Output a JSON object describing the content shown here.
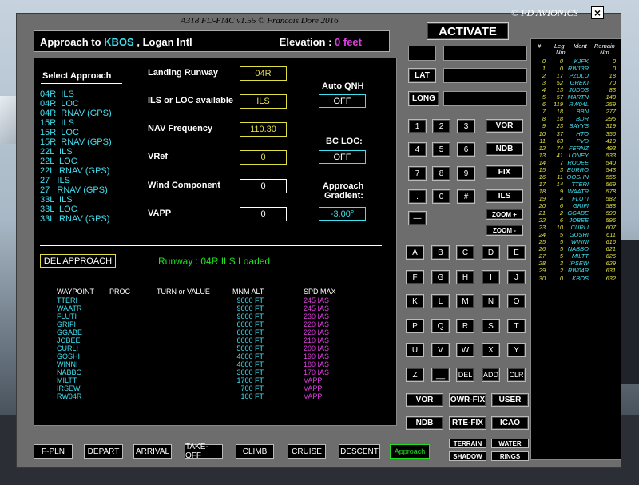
{
  "window": {
    "title": "A318 FD-FMC v1.55 © Francois Dore 2016",
    "brand": "© FD AVIONICS",
    "close_symbol": "×"
  },
  "header": {
    "prefix": "Approach to ",
    "icao": "KBOS",
    "airport": " , Logan Intl",
    "elevation_label": "Elevation : ",
    "elevation_value": "0 feet"
  },
  "approach_list": {
    "title": "Select Approach",
    "items": [
      "04R  ILS",
      "04R  LOC",
      "04R  RNAV (GPS)",
      "15R  ILS",
      "15R  LOC",
      "15R  RNAV (GPS)",
      "22L  ILS",
      "22L  LOC",
      "22L  RNAV (GPS)",
      "27   ILS",
      "27   RNAV (GPS)",
      "33L  ILS",
      "33L  LOC",
      "33L  RNAV (GPS)"
    ]
  },
  "fields": {
    "landing_runway_label": "Landing Runway",
    "landing_runway": "04R",
    "ils_label": "ILS or LOC available",
    "ils_value": "ILS",
    "nav_freq_label": "NAV Frequency",
    "nav_freq": "110.30",
    "vref_label": "VRef",
    "vref": "0",
    "wind_label": "Wind Component",
    "wind": "0",
    "vapp_label": "VAPP",
    "vapp": "0",
    "auto_qnh_label": "Auto QNH",
    "auto_qnh": "OFF",
    "bc_loc_label": "BC LOC:",
    "bc_loc": "OFF",
    "gradient_label_1": "Approach",
    "gradient_label_2": "Gradient:",
    "gradient": "-3.00°"
  },
  "status": {
    "del_approach": "DEL APPROACH",
    "loaded_msg": "Runway : 04R  ILS  Loaded"
  },
  "waypoint_table": {
    "headers": {
      "waypoint": "WAYPOINT",
      "proc": "PROC",
      "turn": "TURN or VALUE",
      "alt": "MNM ALT",
      "spd": "SPD MAX"
    },
    "rows": [
      {
        "wp": "TTERI",
        "alt": "9000 FT",
        "spd": "245 IAS"
      },
      {
        "wp": "WAATR",
        "alt": "9000 FT",
        "spd": "245 IAS"
      },
      {
        "wp": "FLUTI",
        "alt": "9000 FT",
        "spd": "230 IAS"
      },
      {
        "wp": "GRIFI",
        "alt": "6000 FT",
        "spd": "220 IAS"
      },
      {
        "wp": "GGABE",
        "alt": "6000 FT",
        "spd": "220 IAS"
      },
      {
        "wp": "JOBEE",
        "alt": "6000 FT",
        "spd": "210 IAS"
      },
      {
        "wp": "CURLI",
        "alt": "5000 FT",
        "spd": "200 IAS"
      },
      {
        "wp": "GOSHI",
        "alt": "4000 FT",
        "spd": "190 IAS"
      },
      {
        "wp": "WINNI",
        "alt": "4000 FT",
        "spd": "180 IAS"
      },
      {
        "wp": "NABBO",
        "alt": "3000 FT",
        "spd": "170 IAS"
      },
      {
        "wp": "MILTT",
        "alt": "1700 FT",
        "spd": "VAPP"
      },
      {
        "wp": "IRSEW",
        "alt": "700 FT",
        "spd": "VAPP"
      },
      {
        "wp": "RW04R",
        "alt": "100 FT",
        "spd": "VAPP"
      }
    ]
  },
  "keypad": {
    "activate": "ACTIVATE",
    "lat": "LAT",
    "long": "LONG",
    "digits": [
      "1",
      "2",
      "3",
      "4",
      "5",
      "6",
      "7",
      "8",
      "9",
      ".",
      "0",
      "#",
      "—"
    ],
    "nav": {
      "vor": "VOR",
      "ndb": "NDB",
      "fix": "FIX",
      "ils": "ILS",
      "zoom_in": "ZOOM +",
      "zoom_out": "ZOOM -"
    },
    "letters": [
      "A",
      "B",
      "C",
      "D",
      "E",
      "F",
      "G",
      "H",
      "I",
      "J",
      "K",
      "L",
      "M",
      "N",
      "O",
      "P",
      "Q",
      "R",
      "S",
      "T",
      "U",
      "V",
      "W",
      "X",
      "Y",
      "Z",
      "__",
      "DEL",
      "ADD",
      "CLR"
    ],
    "bottom": {
      "vor": "VOR",
      "owr_fix": "OWR-FIX",
      "user": "USER",
      "ndb": "NDB",
      "rte_fix": "RTE-FIX",
      "icao": "ICAO",
      "terrain": "TERRAIN",
      "water": "WATER",
      "shadow": "SHADOW",
      "rings": "RINGS"
    }
  },
  "tabs": [
    "F-PLN",
    "DEPART",
    "ARRIVAL",
    "TAKE-OFF",
    "CLIMB",
    "CRUISE",
    "DESCENT",
    "Approach"
  ],
  "legs": {
    "headers": {
      "num": "#",
      "leg": "Leg",
      "leg_unit": "Nm",
      "ident": "Ident",
      "remain": "Remain",
      "remain_unit": "Nm"
    },
    "rows": [
      {
        "n": "0",
        "l": "0",
        "id": "KJFK",
        "r": "0"
      },
      {
        "n": "1",
        "l": "0",
        "id": "RW13R",
        "r": "0"
      },
      {
        "n": "2",
        "l": "17",
        "id": "PZULU",
        "r": "18"
      },
      {
        "n": "3",
        "l": "52",
        "id": "GREKI",
        "r": "70"
      },
      {
        "n": "4",
        "l": "13",
        "id": "JUDDS",
        "r": "83"
      },
      {
        "n": "5",
        "l": "57",
        "id": "MARTN",
        "r": "140"
      },
      {
        "n": "6",
        "l": "119",
        "id": "RW04L",
        "r": "259"
      },
      {
        "n": "7",
        "l": "18",
        "id": "BBN",
        "r": "277"
      },
      {
        "n": "8",
        "l": "18",
        "id": "BDR",
        "r": "295"
      },
      {
        "n": "9",
        "l": "23",
        "id": "BAYYS",
        "r": "319"
      },
      {
        "n": "10",
        "l": "37",
        "id": "HTO",
        "r": "356"
      },
      {
        "n": "11",
        "l": "63",
        "id": "PVD",
        "r": "419"
      },
      {
        "n": "12",
        "l": "74",
        "id": "FERNZ",
        "r": "493"
      },
      {
        "n": "13",
        "l": "41",
        "id": "LONEY",
        "r": "533"
      },
      {
        "n": "14",
        "l": "7",
        "id": "RODEE",
        "r": "540"
      },
      {
        "n": "15",
        "l": "3",
        "id": "EURRO",
        "r": "543"
      },
      {
        "n": "16",
        "l": "11",
        "id": "OOSHN",
        "r": "555"
      },
      {
        "n": "17",
        "l": "14",
        "id": "TTERI",
        "r": "569"
      },
      {
        "n": "18",
        "l": "9",
        "id": "WAATR",
        "r": "578"
      },
      {
        "n": "19",
        "l": "4",
        "id": "FLUTI",
        "r": "582"
      },
      {
        "n": "20",
        "l": "6",
        "id": "GRIFI",
        "r": "588"
      },
      {
        "n": "21",
        "l": "2",
        "id": "GGABE",
        "r": "590"
      },
      {
        "n": "22",
        "l": "6",
        "id": "JOBEE",
        "r": "596"
      },
      {
        "n": "23",
        "l": "10",
        "id": "CURLI",
        "r": "607"
      },
      {
        "n": "24",
        "l": "5",
        "id": "GOSHI",
        "r": "611"
      },
      {
        "n": "25",
        "l": "5",
        "id": "WINNI",
        "r": "616"
      },
      {
        "n": "26",
        "l": "5",
        "id": "NABBO",
        "r": "621"
      },
      {
        "n": "27",
        "l": "5",
        "id": "MILTT",
        "r": "626"
      },
      {
        "n": "28",
        "l": "3",
        "id": "IRSEW",
        "r": "629"
      },
      {
        "n": "29",
        "l": "2",
        "id": "RW04R",
        "r": "631"
      },
      {
        "n": "30",
        "l": "0",
        "id": "KBOS",
        "r": "632"
      }
    ]
  },
  "colors": {
    "cyan": "#40e0f0",
    "magenta": "#e040e0",
    "green": "#20e020",
    "yellow": "#e0e040",
    "panel": "#6d6d6d"
  }
}
